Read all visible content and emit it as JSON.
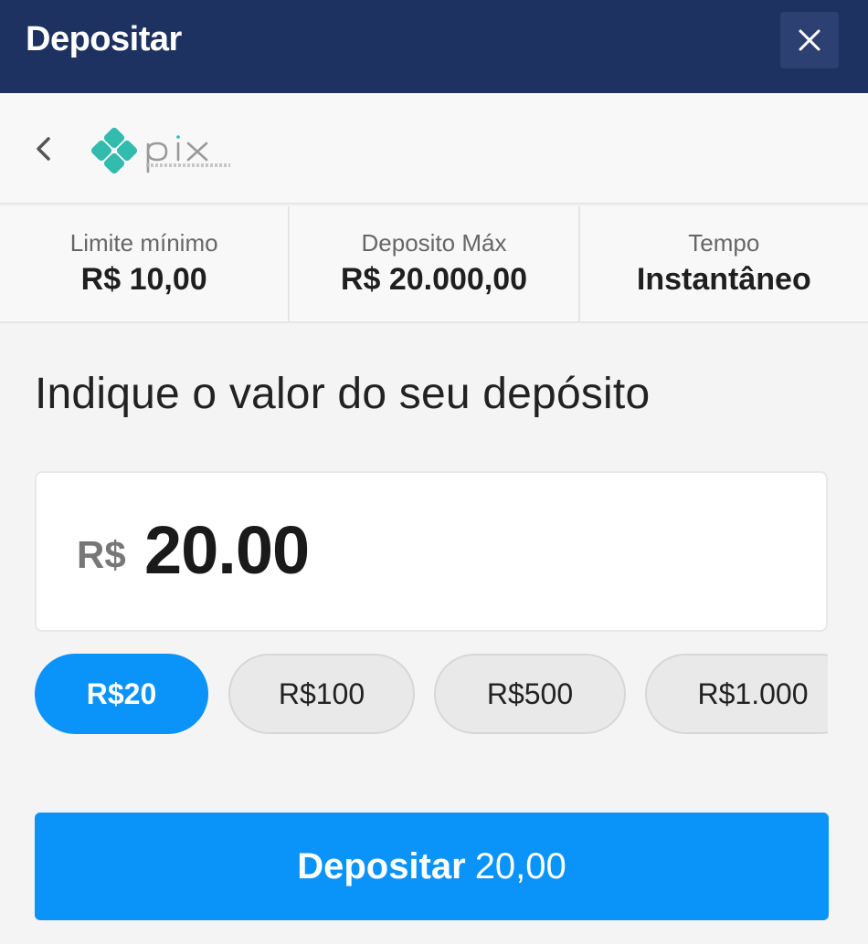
{
  "header": {
    "title": "Depositar",
    "close_icon": "close-icon"
  },
  "method": {
    "back_icon": "chevron-left-icon",
    "logo_name": "pix",
    "logo_color": "#32bcad"
  },
  "limits": {
    "min_label": "Limite mínimo",
    "min_value": "R$ 10,00",
    "max_label": "Deposito Máx",
    "max_value": "R$ 20.000,00",
    "time_label": "Tempo",
    "time_value": "Instantâneo"
  },
  "prompt": "Indique o valor do seu depósito",
  "amount": {
    "currency": "R$",
    "value": "20.00"
  },
  "chips": [
    {
      "label": "R$20",
      "selected": true
    },
    {
      "label": "R$100",
      "selected": false
    },
    {
      "label": "R$500",
      "selected": false
    },
    {
      "label": "R$1.000",
      "selected": false
    }
  ],
  "deposit_button": {
    "label": "Depositar",
    "amount": "20,00"
  },
  "colors": {
    "header_bg": "#1d3260",
    "accent": "#0a93f8",
    "pix_teal": "#32bcad"
  }
}
